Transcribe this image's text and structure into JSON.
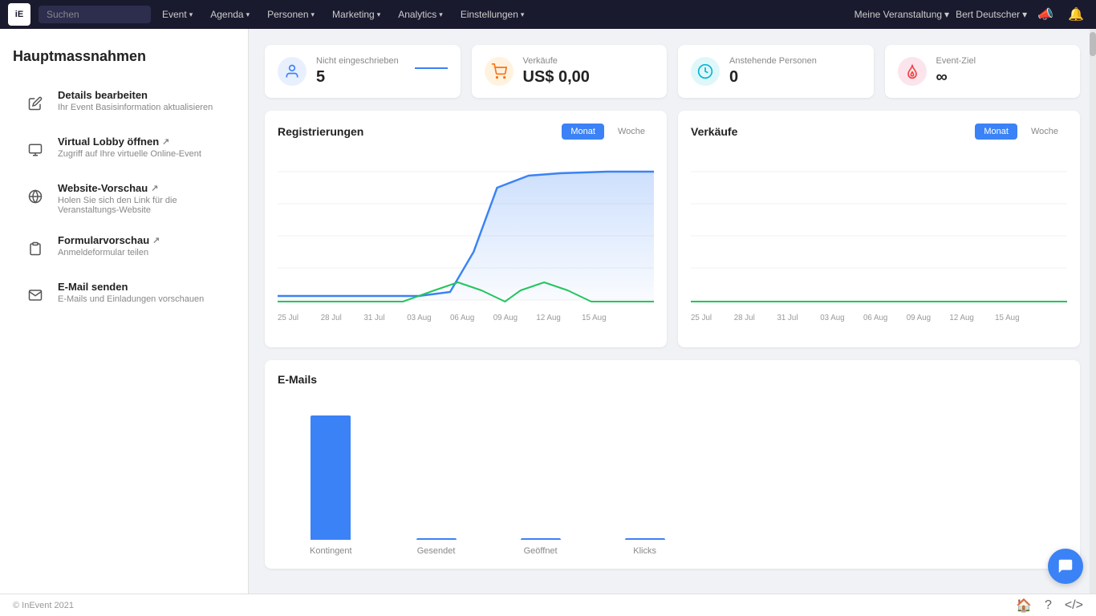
{
  "app": {
    "logo_text": "iE"
  },
  "navbar": {
    "search_placeholder": "Suchen",
    "menu_items": [
      {
        "label": "Event",
        "has_dropdown": true
      },
      {
        "label": "Agenda",
        "has_dropdown": true
      },
      {
        "label": "Personen",
        "has_dropdown": true
      },
      {
        "label": "Marketing",
        "has_dropdown": true
      },
      {
        "label": "Analytics",
        "has_dropdown": true
      },
      {
        "label": "Einstellungen",
        "has_dropdown": true
      }
    ],
    "right_items": [
      {
        "label": "Meine Veranstaltung",
        "has_dropdown": true
      },
      {
        "label": "Bert Deutscher",
        "has_dropdown": true
      }
    ]
  },
  "sidebar": {
    "title": "Hauptmassnahmen",
    "items": [
      {
        "id": "details",
        "label": "Details bearbeiten",
        "sub": "Ihr Event Basisinformation aktualisieren",
        "icon": "pencil",
        "has_ext": false
      },
      {
        "id": "virtual-lobby",
        "label": "Virtual Lobby öffnen",
        "sub": "Zugriff auf Ihre virtuelle Online-Event",
        "icon": "monitor",
        "has_ext": true
      },
      {
        "id": "website",
        "label": "Website-Vorschau",
        "sub": "Holen Sie sich den Link für die Veranstaltungs-Website",
        "icon": "globe",
        "has_ext": true
      },
      {
        "id": "form",
        "label": "Formularvorschau",
        "sub": "Anmeldeformular teilen",
        "icon": "clipboard",
        "has_ext": true
      },
      {
        "id": "email",
        "label": "E-Mail senden",
        "sub": "E-Mails und Einladungen vorschauen",
        "icon": "mail",
        "has_ext": false
      }
    ]
  },
  "stats": [
    {
      "id": "not-registered",
      "label": "Nicht eingeschrieben",
      "value": "5",
      "icon_type": "person",
      "color_class": "stat-icon-blue"
    },
    {
      "id": "sales",
      "label": "Verkäufe",
      "value": "US$ 0,00",
      "icon_type": "cart",
      "color_class": "stat-icon-orange"
    },
    {
      "id": "pending",
      "label": "Anstehende Personen",
      "value": "0",
      "icon_type": "clock",
      "color_class": "stat-icon-teal"
    },
    {
      "id": "event-goal",
      "label": "Event-Ziel",
      "value": "∞",
      "icon_type": "fire",
      "color_class": "stat-icon-red"
    }
  ],
  "registrations_chart": {
    "title": "Registrierungen",
    "toggle_month": "Monat",
    "toggle_week": "Woche",
    "active_toggle": "Monat",
    "x_labels": [
      "25 Jul",
      "28 Jul",
      "31 Jul",
      "03 Aug",
      "06 Aug",
      "09 Aug",
      "12 Aug",
      "15 Aug"
    ]
  },
  "sales_chart": {
    "title": "Verkäufe",
    "toggle_month": "Monat",
    "toggle_week": "Woche",
    "active_toggle": "Monat",
    "x_labels": [
      "25 Jul",
      "28 Jul",
      "31 Jul",
      "03 Aug",
      "06 Aug",
      "09 Aug",
      "12 Aug",
      "15 Aug"
    ]
  },
  "email_chart": {
    "title": "E-Mails",
    "bars": [
      {
        "label": "Kontingent",
        "value": 100,
        "height_pct": 85
      },
      {
        "label": "Gesendet",
        "value": 0,
        "height_pct": 0
      },
      {
        "label": "Geöffnet",
        "value": 0,
        "height_pct": 0
      },
      {
        "label": "Klicks",
        "value": 0,
        "height_pct": 0
      }
    ]
  },
  "footer": {
    "copyright": "© InEvent 2021"
  }
}
